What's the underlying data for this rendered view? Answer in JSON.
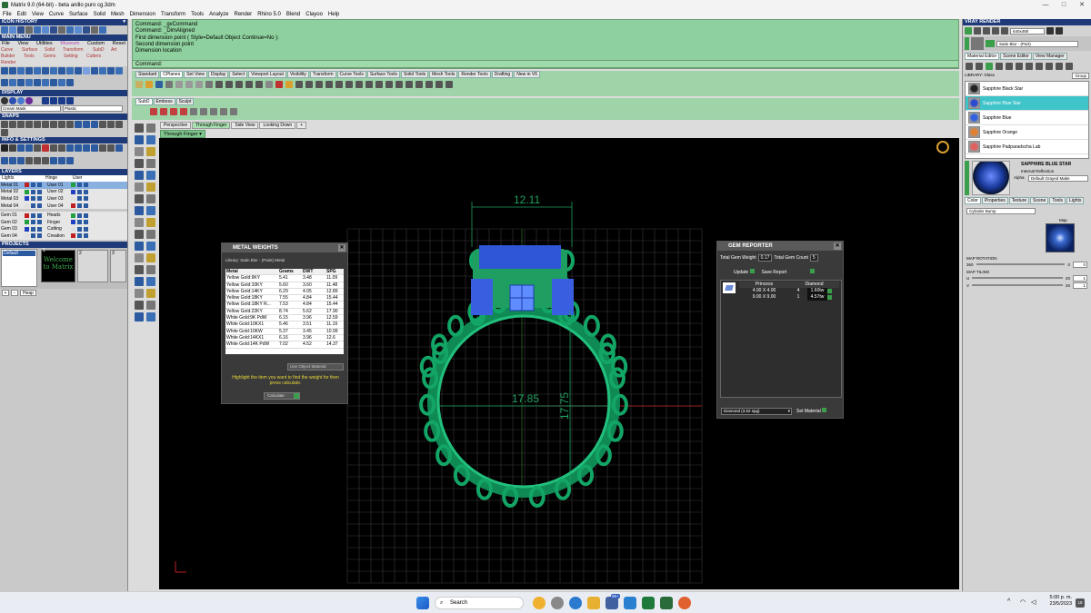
{
  "window": {
    "title": "Matrix 9.0 (64-bit) - beta anillo puro cg.3dm",
    "controls": [
      "—",
      "□",
      "✕"
    ]
  },
  "menubar": [
    "File",
    "Edit",
    "View",
    "Curve",
    "Surface",
    "Solid",
    "Mesh",
    "Dimension",
    "Transform",
    "Tools",
    "Analyze",
    "Render",
    "Rhino 5.0",
    "Blend",
    "Clayoo",
    "Help"
  ],
  "left": {
    "icon_history": "ICON HISTORY",
    "main_menu": "MAIN MENU",
    "main_menu_items": [
      "File",
      "View",
      "Utilities",
      "Museum",
      "Custom",
      "Reset"
    ],
    "builder_rows": [
      "Curve",
      "Surface",
      "Solid",
      "Transform",
      "SubD",
      "Art",
      "Builder",
      "Tools",
      "Gems",
      "Setting",
      "Cutters",
      "Render"
    ],
    "display": "DISPLAY",
    "display_mode": "Cream Mask",
    "display_mode2": "Plastic",
    "snaps": "SNAPS",
    "info_settings": "INFO & SETTINGS",
    "layers": "LAYERS",
    "layers_header": [
      "Lights",
      "Hinge",
      "User"
    ],
    "layers_rows": [
      {
        "a": "Metal 01",
        "b": "User 01"
      },
      {
        "a": "Metal 02",
        "b": "User 02"
      },
      {
        "a": "Metal 03",
        "b": "User 03"
      },
      {
        "a": "Metal 04",
        "b": "User 04"
      },
      {
        "a": "Gem 01",
        "b": "Heads"
      },
      {
        "a": "Gem 02",
        "b": "Finger"
      },
      {
        "a": "Gem 03",
        "b": "Cutting"
      },
      {
        "a": "Gem 04",
        "b": "Creation"
      }
    ],
    "projects": "PROJECTS",
    "project_default": "Default",
    "project_slots": [
      "1",
      "2",
      "3"
    ],
    "welcome_text": "Welcome to Matrix",
    "heap_label": "Heap"
  },
  "command": {
    "lines": [
      "Command: _gvCommand",
      "Command: _DimAligned",
      "First dimension point ( Style=Default  Object  Continue=No ):",
      "Second dimension point",
      "Dimension location"
    ],
    "prompt": "Command:"
  },
  "toolbar_tabs": [
    "Standard",
    "CPlanes",
    "Set View",
    "Display",
    "Select",
    "Viewport Layout",
    "Visibility",
    "Transform",
    "Curve Tools",
    "Surface Tools",
    "Solid Tools",
    "Mesh Tools",
    "Render Tools",
    "Drafting",
    "New in V6"
  ],
  "toolbar_tabs2": [
    "SubD",
    "Emboss",
    "Sculpt"
  ],
  "viewport_tabs": [
    "Perspective",
    "Through Finger",
    "Side View",
    "Looking Down",
    "+"
  ],
  "viewport_name": "Through Finger",
  "dimensions": {
    "top": "12.11",
    "horizontal": "17.85",
    "vertical": "17.75"
  },
  "metal": {
    "title": "METAL WEIGHTS",
    "library": "Library: Satin Blur - (Paint) Metal",
    "headers": [
      "Metal",
      "Grams",
      "DWT",
      "SPG"
    ],
    "rows": [
      [
        "Yellow Gold:9KY",
        "5.41",
        "3.48",
        "11.09"
      ],
      [
        "Yellow Gold:10KY",
        "5.60",
        "3.60",
        "11.48"
      ],
      [
        "Yellow Gold:14KY",
        "6.29",
        "4.05",
        "12.89"
      ],
      [
        "Yellow Gold:18KY",
        "7.55",
        "4.84",
        "15.44"
      ],
      [
        "Yellow Gold:18KY R...",
        "7.53",
        "4.84",
        "15.44"
      ],
      [
        "Yellow Gold:22KY",
        "8.74",
        "5.62",
        "17.90"
      ],
      [
        "White Gold:9K PdW",
        "6.15",
        "3.96",
        "12.59"
      ],
      [
        "White Gold:10KX1",
        "5.46",
        "3.51",
        "11.19"
      ],
      [
        "White Gold:10KW",
        "5.37",
        "3.45",
        "10.99"
      ],
      [
        "White Gold:14KX1",
        "6.16",
        "3.96",
        "12.6"
      ],
      [
        "White Gold:14K PdW",
        "7.02",
        "4.52",
        "14.37"
      ]
    ],
    "object_material": "Use Object Material",
    "hint": "Highlight the item you want to find the weight for then press calculate.",
    "calc": "Calculate"
  },
  "gem": {
    "title": "GEM REPORTER",
    "total_weight_label": "Total Gem Weight",
    "total_weight": "0.17",
    "total_count_label": "Total Gem Count",
    "total_count": "5",
    "update": "Update",
    "save": "Save Report",
    "headers": [
      "Princess",
      "Diamond"
    ],
    "rows": [
      {
        "size": "4.00 X 4.00",
        "count": "4",
        "ct": "1.60tw"
      },
      {
        "size": "9.00 X 9.00",
        "count": "1",
        "ct": "4.57tw"
      }
    ],
    "material": "Diamond",
    "material_spg": "(3.52 spg)",
    "set_material": "Set Material"
  },
  "vray": {
    "title": "VRAY RENDER",
    "resolution": "640x480",
    "material_current": "Satin Blur - (Part)",
    "tabs": [
      "Material Editor",
      "Scene Editor",
      "View Manager"
    ],
    "library_label": "LIBRARY: Glass",
    "group": "Group",
    "materials": [
      "Sapphire Black Star",
      "Sapphire Blue Star",
      "Sapphire Blue",
      "Sapphire Orange",
      "Sapphire Padparadscha Lab"
    ],
    "selected_name": "SAPPHIRE BLUE STAR",
    "internal_reflection": "Internal Reflection",
    "alpha_label": "Alpha",
    "alpha_value": "Default Grayed Make",
    "sub_tabs": [
      "Color",
      "Properties",
      "Texture",
      "Scene",
      "Tools",
      "Lights"
    ],
    "map_type": "Cylinder Bump",
    "map_label": "Map",
    "map_rotation": "MAP ROTATION",
    "map_rotation_val": "0",
    "map_tiling": "MAP TILING",
    "tile_u_label": "U",
    "tile_v_label": "V",
    "tile_u": "1",
    "tile_v": "1",
    "rot_ticks": [
      "360",
      "0"
    ],
    "tile_ticks": [
      "20",
      "20"
    ],
    "accent": "#3fc4c9"
  },
  "taskbar": {
    "search": "Search",
    "time": "5:00 p. m.",
    "date": "23/5/2023",
    "badge": "99+",
    "notif": "18"
  }
}
